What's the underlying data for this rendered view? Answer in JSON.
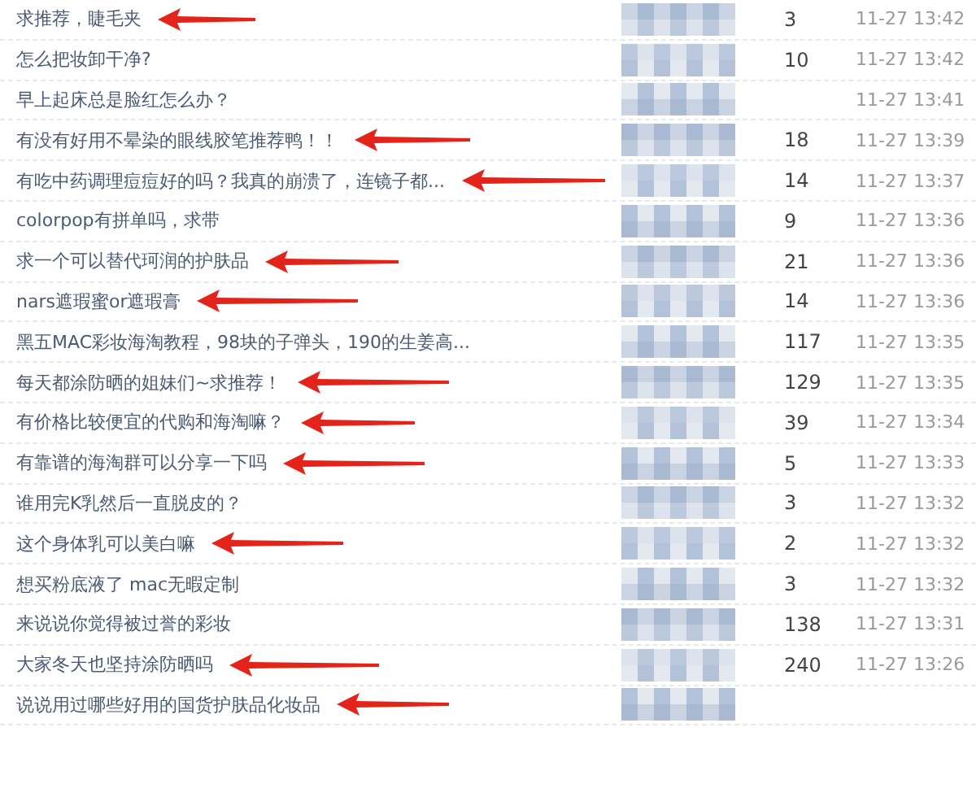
{
  "rows": [
    {
      "title": "求推荐，睫毛夹",
      "replies": "3",
      "time": "11-27 13:42",
      "arrow": true
    },
    {
      "title": "怎么把妆卸干净?",
      "replies": "10",
      "time": "11-27 13:42",
      "arrow": false
    },
    {
      "title": "早上起床总是脸红怎么办？",
      "time": "11-27 13:41",
      "arrow": false
    },
    {
      "title": "有没有好用不晕染的眼线胶笔推荐鸭！！",
      "replies": "18",
      "time": "11-27 13:39",
      "arrow": true
    },
    {
      "title": "有吃中药调理痘痘好的吗？我真的崩溃了，连镜子都...",
      "replies": "14",
      "time": "11-27 13:37",
      "arrow": true
    },
    {
      "title": "colorpop有拼单吗，求带",
      "replies": "9",
      "time": "11-27 13:36",
      "arrow": false
    },
    {
      "title": "求一个可以替代珂润的护肤品",
      "replies": "21",
      "time": "11-27 13:36",
      "arrow": true
    },
    {
      "title": "nars遮瑕蜜or遮瑕膏",
      "replies": "14",
      "time": "11-27 13:36",
      "arrow": true
    },
    {
      "title": "黑五MAC彩妆海淘教程，98块的子弹头，190的生姜高...",
      "replies": "117",
      "time": "11-27 13:35",
      "arrow": false
    },
    {
      "title": "每天都涂防晒的姐妹们~求推荐！",
      "replies": "129",
      "time": "11-27 13:35",
      "arrow": true
    },
    {
      "title": "有价格比较便宜的代购和海淘嘛？",
      "replies": "39",
      "time": "11-27 13:34",
      "arrow": true
    },
    {
      "title": "有靠谱的海淘群可以分享一下吗",
      "replies": "5",
      "time": "11-27 13:33",
      "arrow": true
    },
    {
      "title": "谁用完K乳然后一直脱皮的？",
      "replies": "3",
      "time": "11-27 13:32",
      "arrow": false
    },
    {
      "title": "这个身体乳可以美白嘛",
      "replies": "2",
      "time": "11-27 13:32",
      "arrow": true
    },
    {
      "title": "想买粉底液了 mac无暇定制",
      "replies": "3",
      "time": "11-27 13:32",
      "arrow": false
    },
    {
      "title": "来说说你觉得被过誉的彩妆",
      "replies": "138",
      "time": "11-27 13:31",
      "arrow": false
    },
    {
      "title": "大家冬天也坚持涂防晒吗",
      "replies": "240",
      "time": "11-27 13:26",
      "arrow": true
    },
    {
      "title": "说说用过哪些好用的国货护肤品化妆品",
      "arrow": true
    }
  ]
}
